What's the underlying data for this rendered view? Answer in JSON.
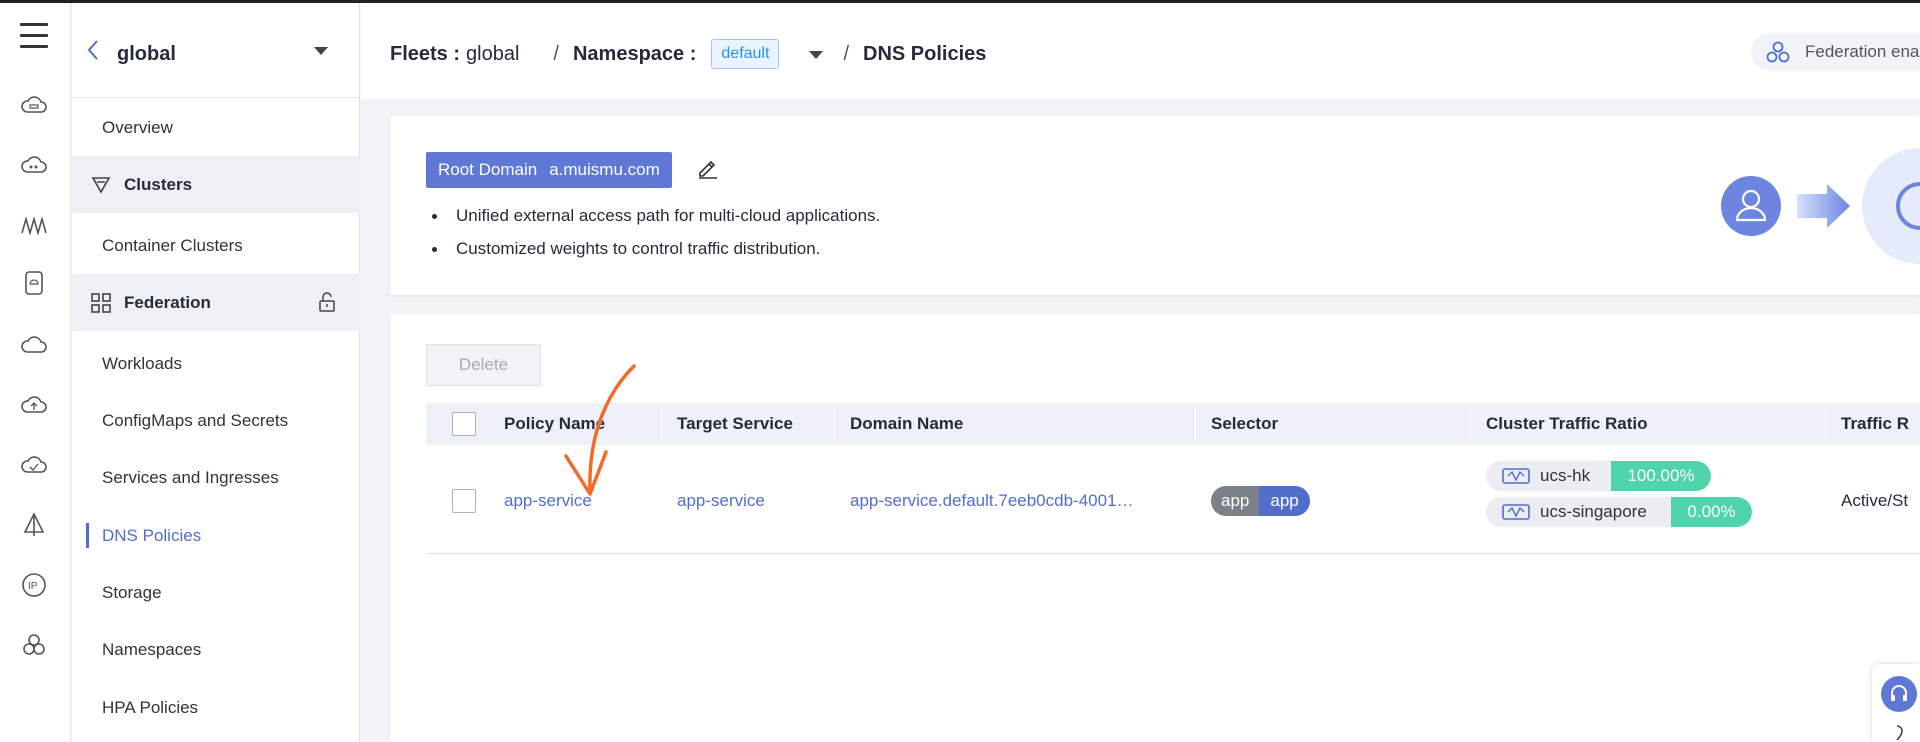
{
  "nav": {
    "title": "global",
    "items": [
      {
        "label": "Overview"
      },
      {
        "label": "Clusters"
      },
      {
        "label": "Container Clusters"
      },
      {
        "label": "Federation"
      },
      {
        "label": "Workloads"
      },
      {
        "label": "ConfigMaps and Secrets"
      },
      {
        "label": "Services and Ingresses"
      },
      {
        "label": "DNS Policies"
      },
      {
        "label": "Storage"
      },
      {
        "label": "Namespaces"
      },
      {
        "label": "HPA Policies"
      }
    ]
  },
  "header": {
    "fleets_label": "Fleets :",
    "fleets_value": "global",
    "namespace_label": "Namespace :",
    "namespace_value": "default",
    "page": "DNS Policies",
    "federation_status": "Federation ena"
  },
  "banner": {
    "root_domain_label": "Root Domain",
    "root_domain_value": "a.muismu.com",
    "bullets": [
      "Unified external access path for multi-cloud applications.",
      "Customized weights to control traffic distribution."
    ]
  },
  "toolbar": {
    "delete_label": "Delete"
  },
  "table": {
    "columns": [
      "Policy Name",
      "Target Service",
      "Domain Name",
      "Selector",
      "Cluster Traffic Ratio",
      "Traffic R"
    ],
    "rows": [
      {
        "policy_name": "app-service",
        "target_service": "app-service",
        "domain_name": "app-service.default.7eeb0cdb-4001…",
        "selector_key": "app",
        "selector_value": "app",
        "ratios": [
          {
            "cluster": "ucs-hk",
            "percent": "100.00%"
          },
          {
            "cluster": "ucs-singapore",
            "percent": "0.00%"
          }
        ],
        "traffic_mode": "Active/St"
      }
    ]
  },
  "colors": {
    "primary": "#5f78d6",
    "link": "#526ecc",
    "ratio_green": "#50d4ab",
    "annotation": "#f26b2a"
  },
  "icons": [
    "menu-icon",
    "cloud-icon",
    "back-chevron-icon",
    "filter-icon",
    "grid-icon",
    "unlock-icon",
    "federation-icon",
    "edit-icon",
    "user-icon",
    "arrow-icon",
    "globe-icon",
    "cluster-icon",
    "headset-icon"
  ]
}
